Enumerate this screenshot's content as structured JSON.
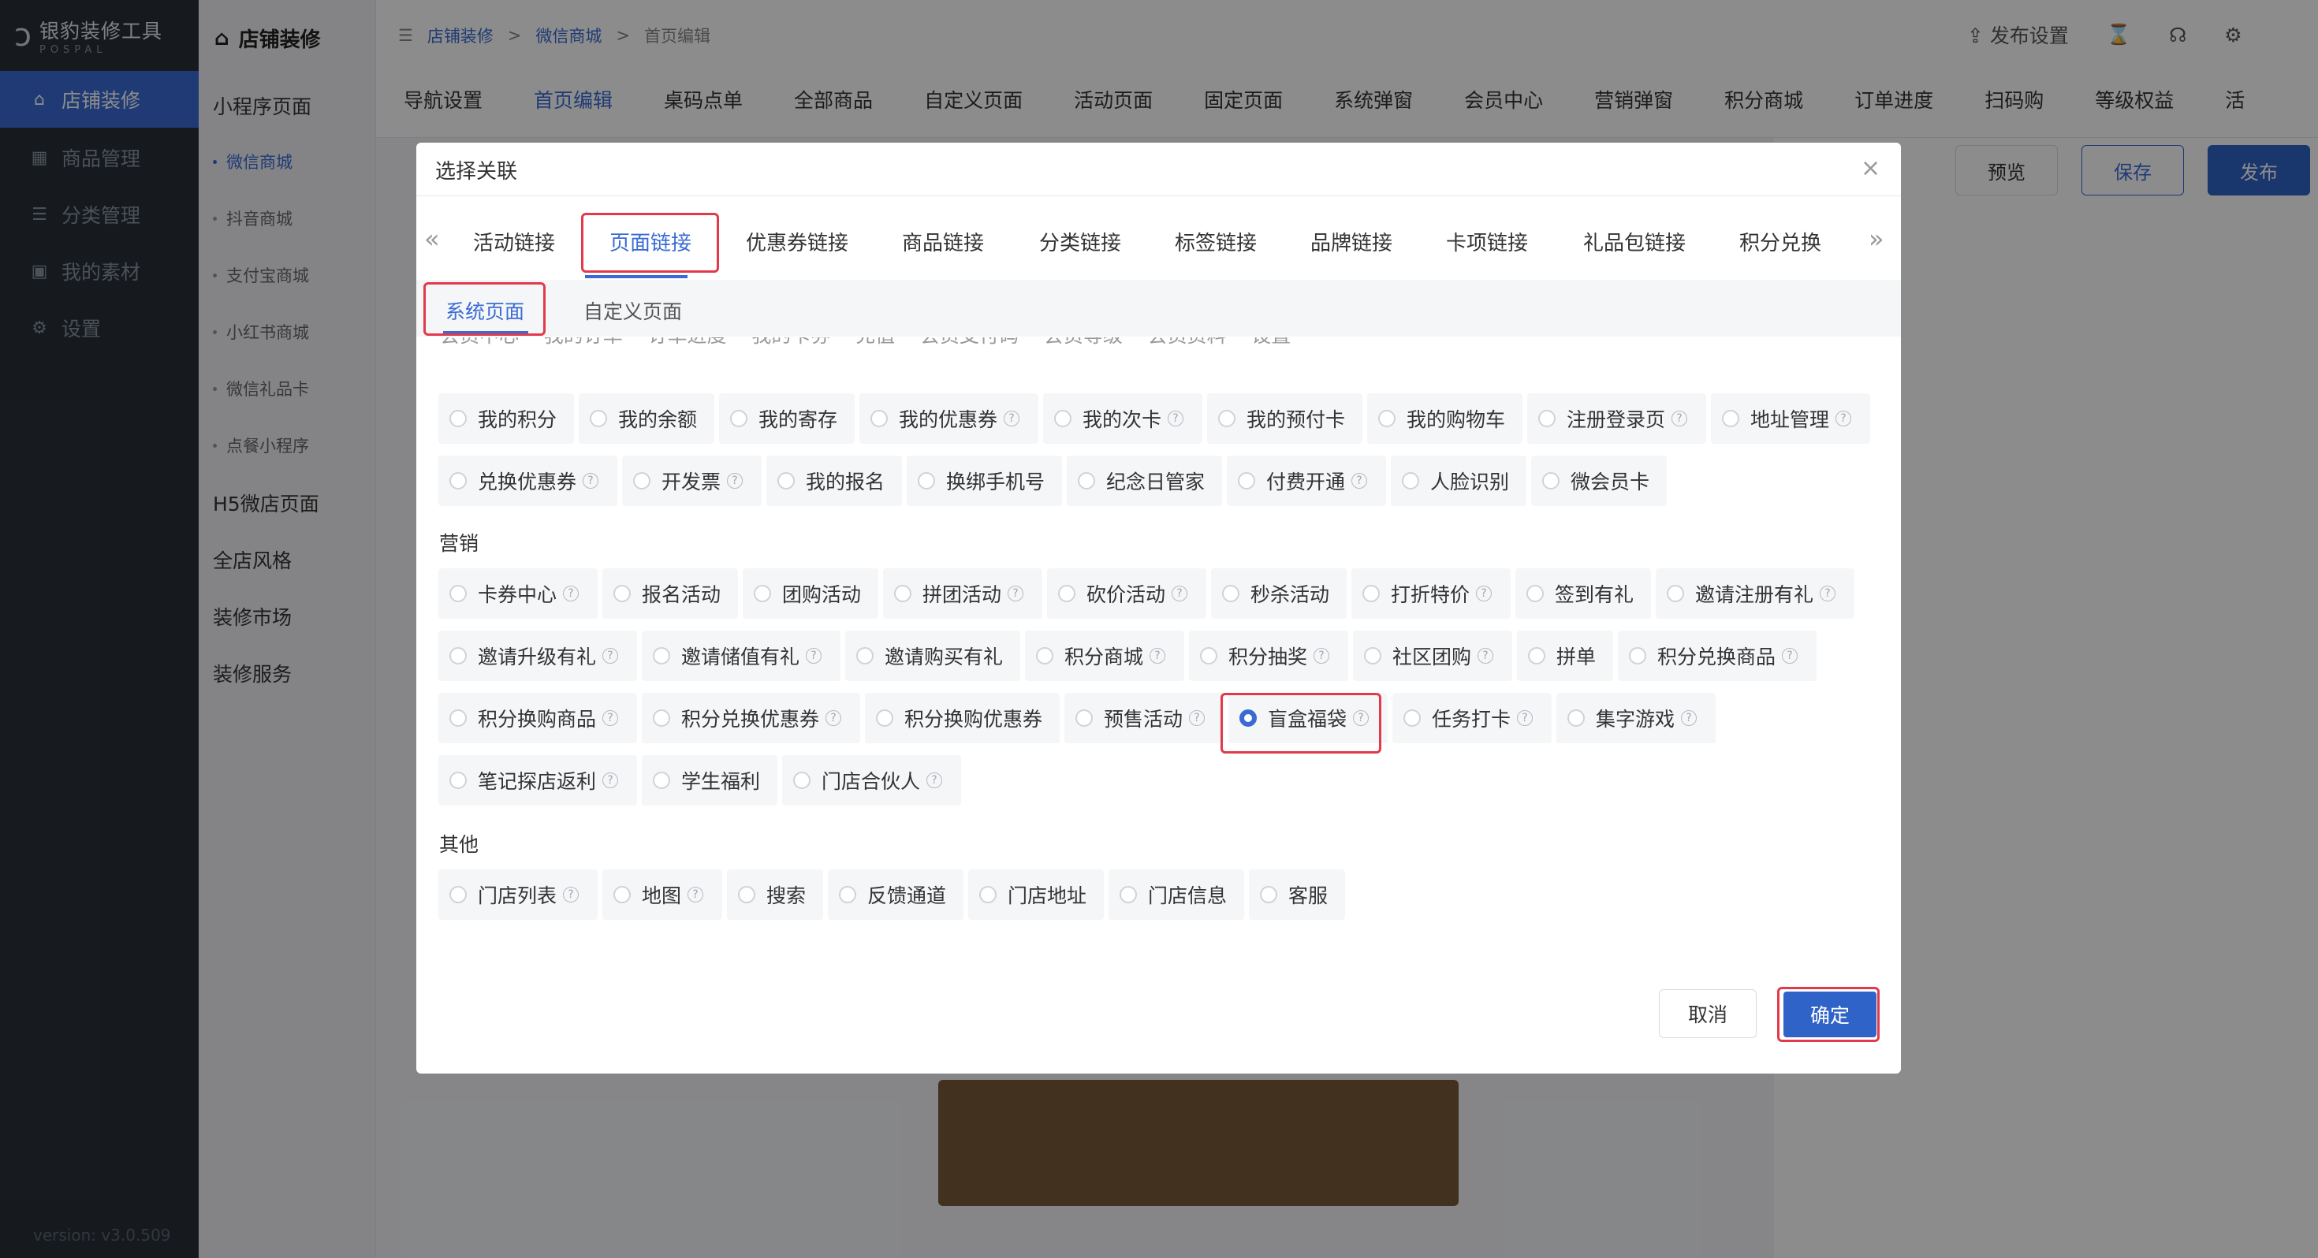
{
  "sidebar": {
    "logo_title": "银豹装修工具",
    "logo_sub": "POSPAL",
    "items": [
      {
        "label": "店铺装修",
        "icon": "store-icon"
      },
      {
        "label": "商品管理",
        "icon": "grid-icon"
      },
      {
        "label": "分类管理",
        "icon": "list-icon"
      },
      {
        "label": "我的素材",
        "icon": "image-icon"
      },
      {
        "label": "设置",
        "icon": "gear-icon"
      }
    ],
    "version": "version: v3.0.509"
  },
  "subnav": {
    "title": "店铺装修",
    "mini_program": "小程序页面",
    "mini_items": [
      "微信商城",
      "抖音商城",
      "支付宝商城",
      "小红书商城",
      "微信礼品卡",
      "点餐小程序"
    ],
    "h5": "H5微店页面",
    "style": "全店风格",
    "market": "装修市场",
    "service": "装修服务"
  },
  "header": {
    "breadcrumb": [
      "店铺装修",
      "微信商城",
      "首页编辑"
    ],
    "sep": ">",
    "publish_settings": "发布设置",
    "main_tabs": [
      "导航设置",
      "首页编辑",
      "桌码点单",
      "全部商品",
      "自定义页面",
      "活动页面",
      "固定页面",
      "系统弹窗",
      "会员中心",
      "营销弹窗",
      "积分商城",
      "订单进度",
      "扫码购",
      "等级权益",
      "活"
    ],
    "preview": "预览",
    "save": "保存",
    "publish": "发布"
  },
  "modal": {
    "title": "选择关联",
    "close": "×",
    "link_tabs": [
      "活动链接",
      "页面链接",
      "优惠券链接",
      "商品链接",
      "分类链接",
      "标签链接",
      "品牌链接",
      "卡项链接",
      "礼品包链接",
      "积分兑换"
    ],
    "prev_arrow": "«",
    "next_arrow": "»",
    "subtabs": [
      "系统页面",
      "自定义页面"
    ],
    "clipped_row": "会员中心    我的订单    订单进度    我的卡券    充值    会员支付码    会员等级    会员资料    设置",
    "member_rows": [
      [
        "我的积分",
        "我的余额",
        "我的寄存",
        "我的优惠券?",
        "我的次卡?",
        "我的预付卡",
        "我的购物车",
        "注册登录页?",
        "地址管理?"
      ],
      [
        "兑换优惠券?",
        "开发票?",
        "我的报名",
        "换绑手机号",
        "纪念日管家",
        "付费开通?",
        "人脸识别",
        "微会员卡"
      ]
    ],
    "group_marketing": "营销",
    "marketing_rows": [
      [
        "卡券中心?",
        "报名活动",
        "团购活动",
        "拼团活动?",
        "砍价活动?",
        "秒杀活动",
        "打折特价?",
        "签到有礼",
        "邀请注册有礼?"
      ],
      [
        "邀请升级有礼?",
        "邀请储值有礼?",
        "邀请购买有礼",
        "积分商城?",
        "积分抽奖?",
        "社区团购?",
        "拼单",
        "积分兑换商品?"
      ],
      [
        "积分换购商品?",
        "积分兑换优惠券?",
        "积分换购优惠券",
        "预售活动?",
        "盲盒福袋?",
        "任务打卡?",
        "集字游戏?"
      ],
      [
        "笔记探店返利?",
        "学生福利",
        "门店合伙人?"
      ]
    ],
    "group_other": "其他",
    "other_rows": [
      [
        "门店列表?",
        "地图?",
        "搜索",
        "反馈通道",
        "门店地址",
        "门店信息",
        "客服"
      ]
    ],
    "selected": "盲盒福袋",
    "cancel": "取消",
    "ok": "确定"
  },
  "colors": {
    "accent": "#3a6bd4",
    "highlight": "#e23a4a",
    "sidebar": "#293038"
  }
}
